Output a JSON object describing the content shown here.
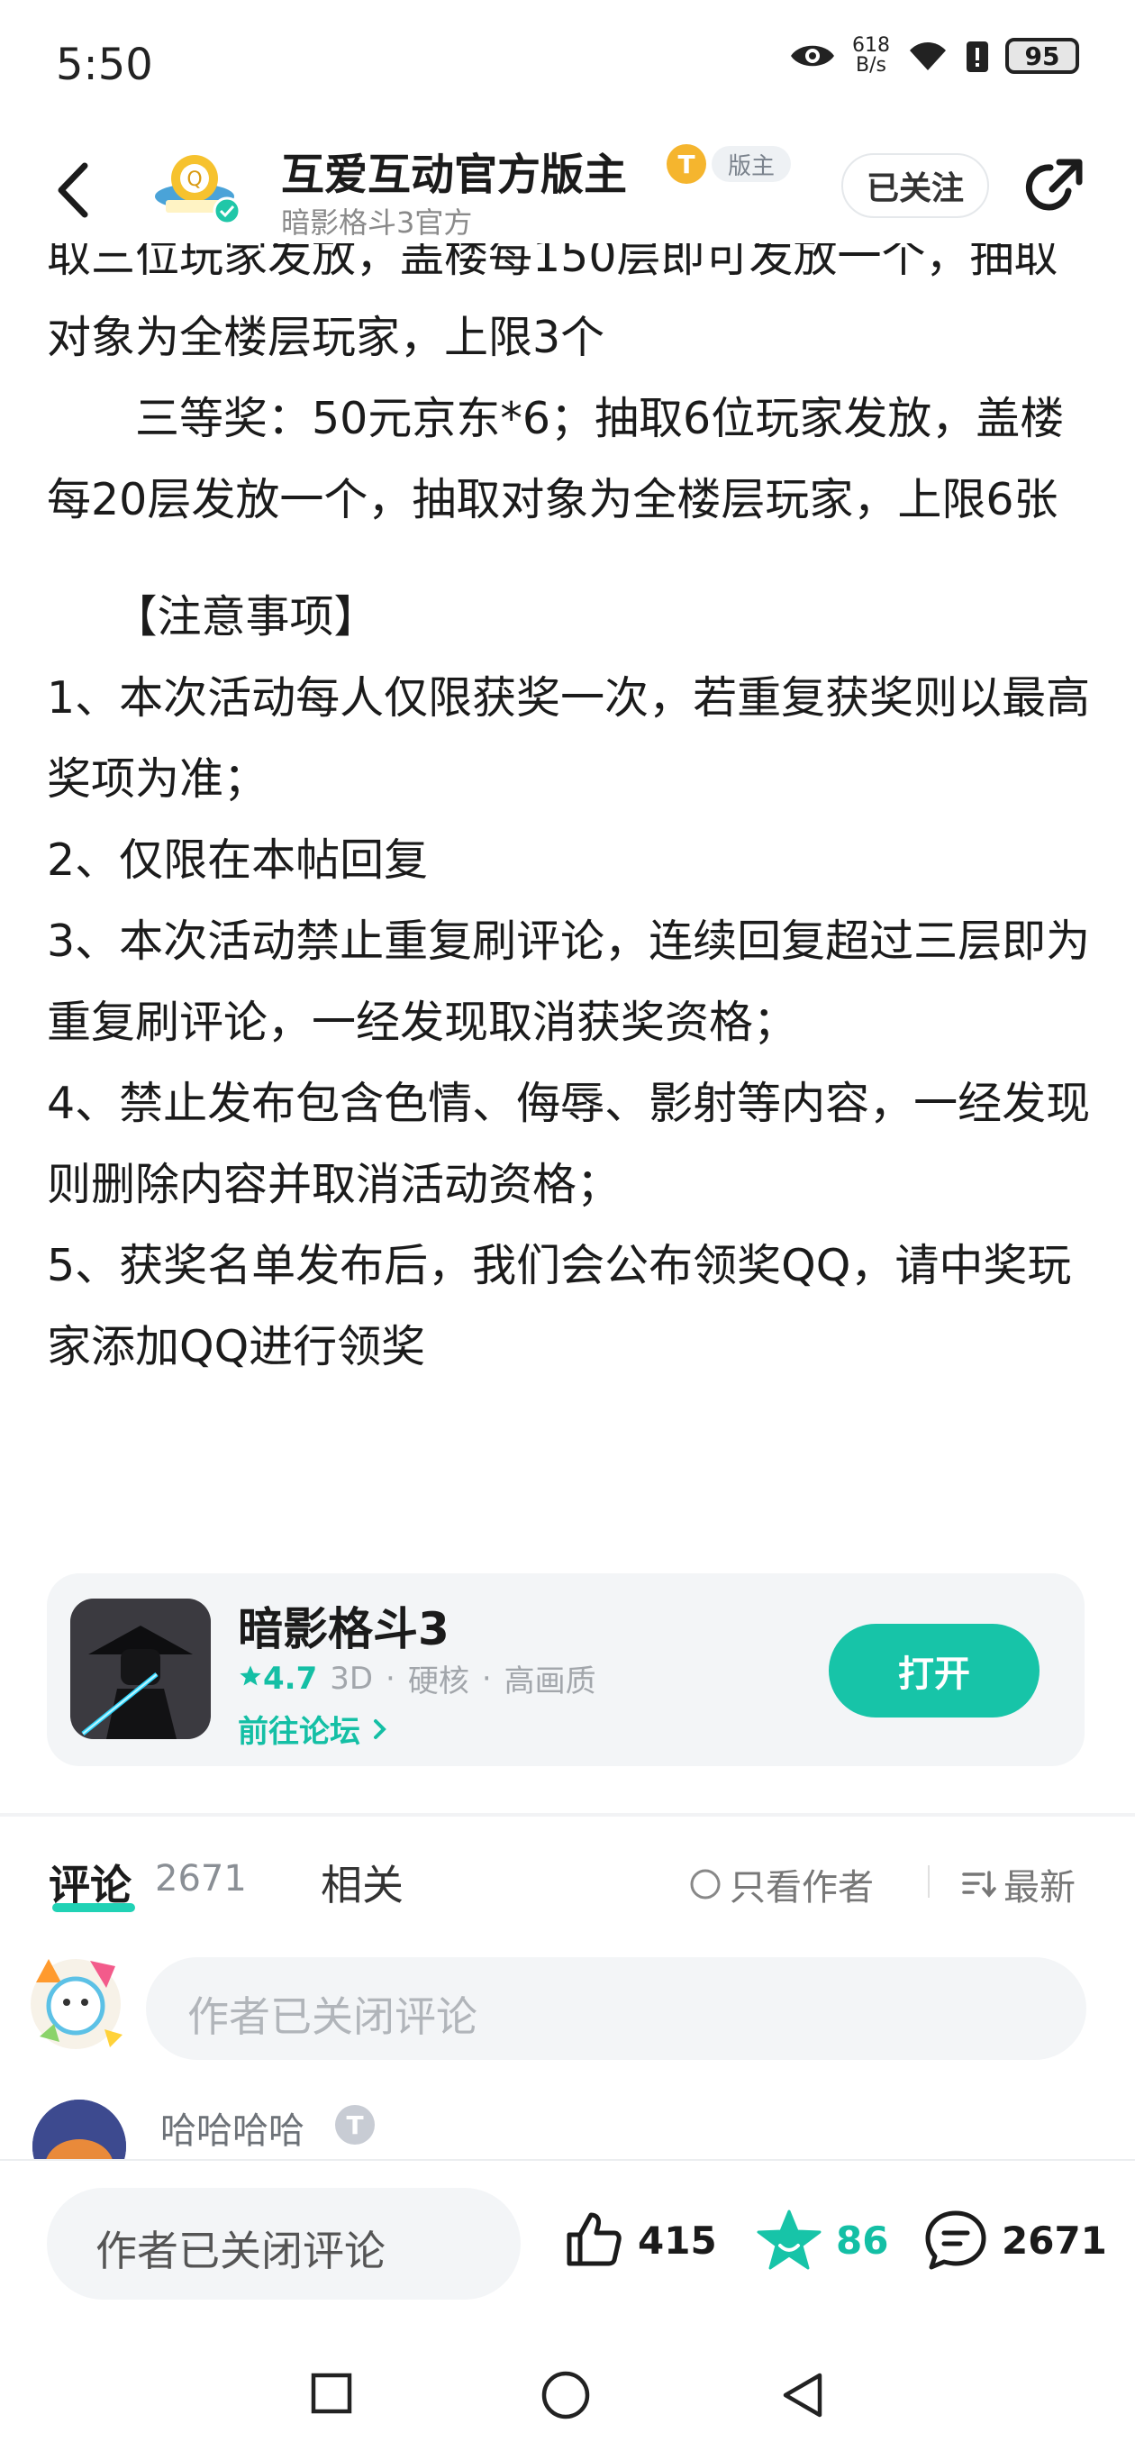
{
  "status_bar": {
    "time": "5:50",
    "net_speed_value": "618",
    "net_speed_unit": "B/s",
    "battery": "95"
  },
  "header": {
    "author_name": "互爱互动官方版主",
    "author_subtitle": "暗影格斗3官方",
    "level_badge": "T",
    "role_badge": "版主",
    "follow_label": "已关注"
  },
  "post": {
    "paragraphs": [
      "取三位玩家发放，盖楼每150层即可发放一个，抽取对象为全楼层玩家，上限3个",
      "　　三等奖：50元京东*6；抽取6位玩家发放，盖楼每20层发放一个，抽取对象为全楼层玩家，上限6张",
      "　　【注意事项】",
      "1、本次活动每人仅限获奖一次，若重复获奖则以最高奖项为准；",
      "2、仅限在本帖回复",
      "3、本次活动禁止重复刷评论，连续回复超过三层即为重复刷评论，一经发现取消获奖资格；",
      "4、禁止发布包含色情、侮辱、影射等内容，一经发现则删除内容并取消活动资格；",
      "5、获奖名单发布后，我们会公布领奖QQ，请中奖玩家添加QQ进行领奖"
    ]
  },
  "app_card": {
    "name": "暗影格斗3",
    "rating": "4.7",
    "tags": [
      "3D",
      "硬核",
      "高画质"
    ],
    "tag_separator": "·",
    "forum_link": "前往论坛",
    "open_label": "打开",
    "accent_color": "#17c4a8"
  },
  "tabs": {
    "comments_label": "评论",
    "comments_count": "2671",
    "related_label": "相关",
    "author_only_label": "只看作者",
    "sort_label": "最新"
  },
  "comment_input": {
    "placeholder": "作者已关闭评论"
  },
  "first_comment": {
    "username": "哈哈哈哈",
    "level_badge": "T"
  },
  "bottom_bar": {
    "input_text": "作者已关闭评论",
    "likes": "415",
    "favorites": "86",
    "comments": "2671"
  },
  "icons": {
    "back": "back-arrow-icon",
    "share": "share-icon",
    "like": "thumbs-up-icon",
    "favorite": "star-icon",
    "comment": "comment-bubble-icon"
  }
}
